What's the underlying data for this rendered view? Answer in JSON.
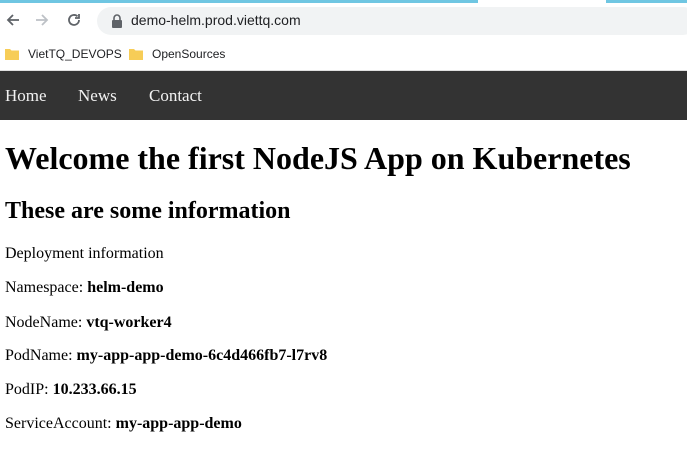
{
  "browser": {
    "url": "demo-helm.prod.viettq.com",
    "bookmarks": [
      {
        "label": "VietTQ_DEVOPS",
        "icon": "folder-icon"
      },
      {
        "label": "OpenSources",
        "icon": "folder-icon"
      }
    ],
    "icons": {
      "back": "arrow-left-icon",
      "forward": "arrow-right-icon",
      "reload": "reload-icon",
      "lock": "lock-icon"
    },
    "colors": {
      "tab_accent": "#6fc6e2",
      "omnibox_bg": "#f1f3f4",
      "folder": "#f7cd57"
    }
  },
  "nav": {
    "items": [
      "Home",
      "News",
      "Contact"
    ],
    "bg_color": "#333333",
    "text_color": "#f2f2f2"
  },
  "page": {
    "title": "Welcome the first NodeJS App on Kubernetes",
    "subtitle": "These are some information",
    "section_label": "Deployment information",
    "fields": [
      {
        "label": "Namespace:",
        "value": "helm-demo"
      },
      {
        "label": "NodeName:",
        "value": "vtq-worker4"
      },
      {
        "label": "PodName:",
        "value": "my-app-app-demo-6c4d466fb7-l7rv8"
      },
      {
        "label": "PodIP:",
        "value": "10.233.66.15"
      },
      {
        "label": "ServiceAccount:",
        "value": "my-app-app-demo"
      }
    ]
  }
}
